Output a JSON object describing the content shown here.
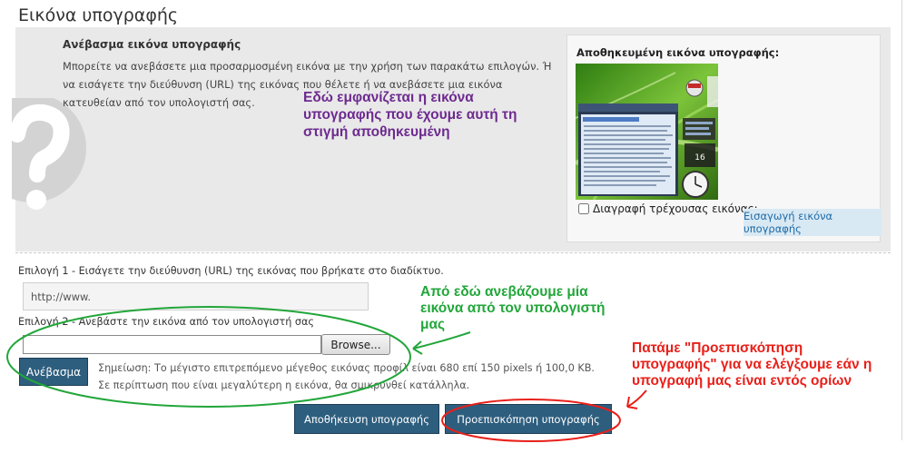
{
  "page": {
    "title": "Εικόνα υπογραφής"
  },
  "upload_section": {
    "heading": "Ανέβασμα εικόνα υπογραφής",
    "description": "Μπορείτε να ανεβάσετε μια προσαρμοσμένη εικόνα με την χρήση των παρακάτω επιλογών. Ή να εισάγετε την διεύθυνση (URL) της εικόνας που θέλετε ή να ανεβάσετε μια εικόνα κατευθείαν από τον υπολογιστή σας."
  },
  "stored_signature": {
    "label": "Αποθηκευμένη εικόνα υπογραφής:",
    "delete_label": "Διαγραφή τρέχουσας εικόνας;",
    "insert_button": "Εισαγωγή εικόνα υπογραφής"
  },
  "option1": {
    "label": "Επιλογή 1 - Εισάγετε την διεύθυνση (URL) της εικόνας που βρήκατε στο διαδίκτυο.",
    "value": "http://www."
  },
  "option2": {
    "label": "Επιλογή 2 - Ανεβάστε την εικόνα από τον υπολογιστή σας",
    "browse_label": "Browse...",
    "upload_label": "Ανέβασμα",
    "note_line1": "Σημείωση: Το μέγιστο επιτρεπόμενο μέγεθος εικόνας προφίλ είναι 680 επί 150 pixels ή 100,0 KB.",
    "note_line2": "Σε περίπτωση που είναι μεγαλύτερη η εικόνα, θα σμικρυνθεί κατάλληλα."
  },
  "actions": {
    "save_label": "Αποθήκευση υπογραφής",
    "preview_label": "Προεπισκόπηση υπογραφής"
  },
  "annotations": {
    "purple": "Εδώ εμφανίζεται η εικόνα υπογραφής που έχουμε αυτή τη στιγμή αποθηκευμένη",
    "green": "Από εδώ ανεβάζουμε μία εικόνα από τον υπολογιστή μας",
    "red": "Πατάμε \"Προεπισκόπηση υπογραφής\" για να ελέγξουμε εάν η υπογραφή μας είναι εντός ορίων"
  },
  "colors": {
    "panel_bg": "#e9e9e9",
    "button_bg": "#2e5e7e",
    "link_blue": "#1e6aa7",
    "annotation_purple": "#6d2a8f",
    "annotation_green": "#22a63a",
    "annotation_red": "#e8201a"
  }
}
